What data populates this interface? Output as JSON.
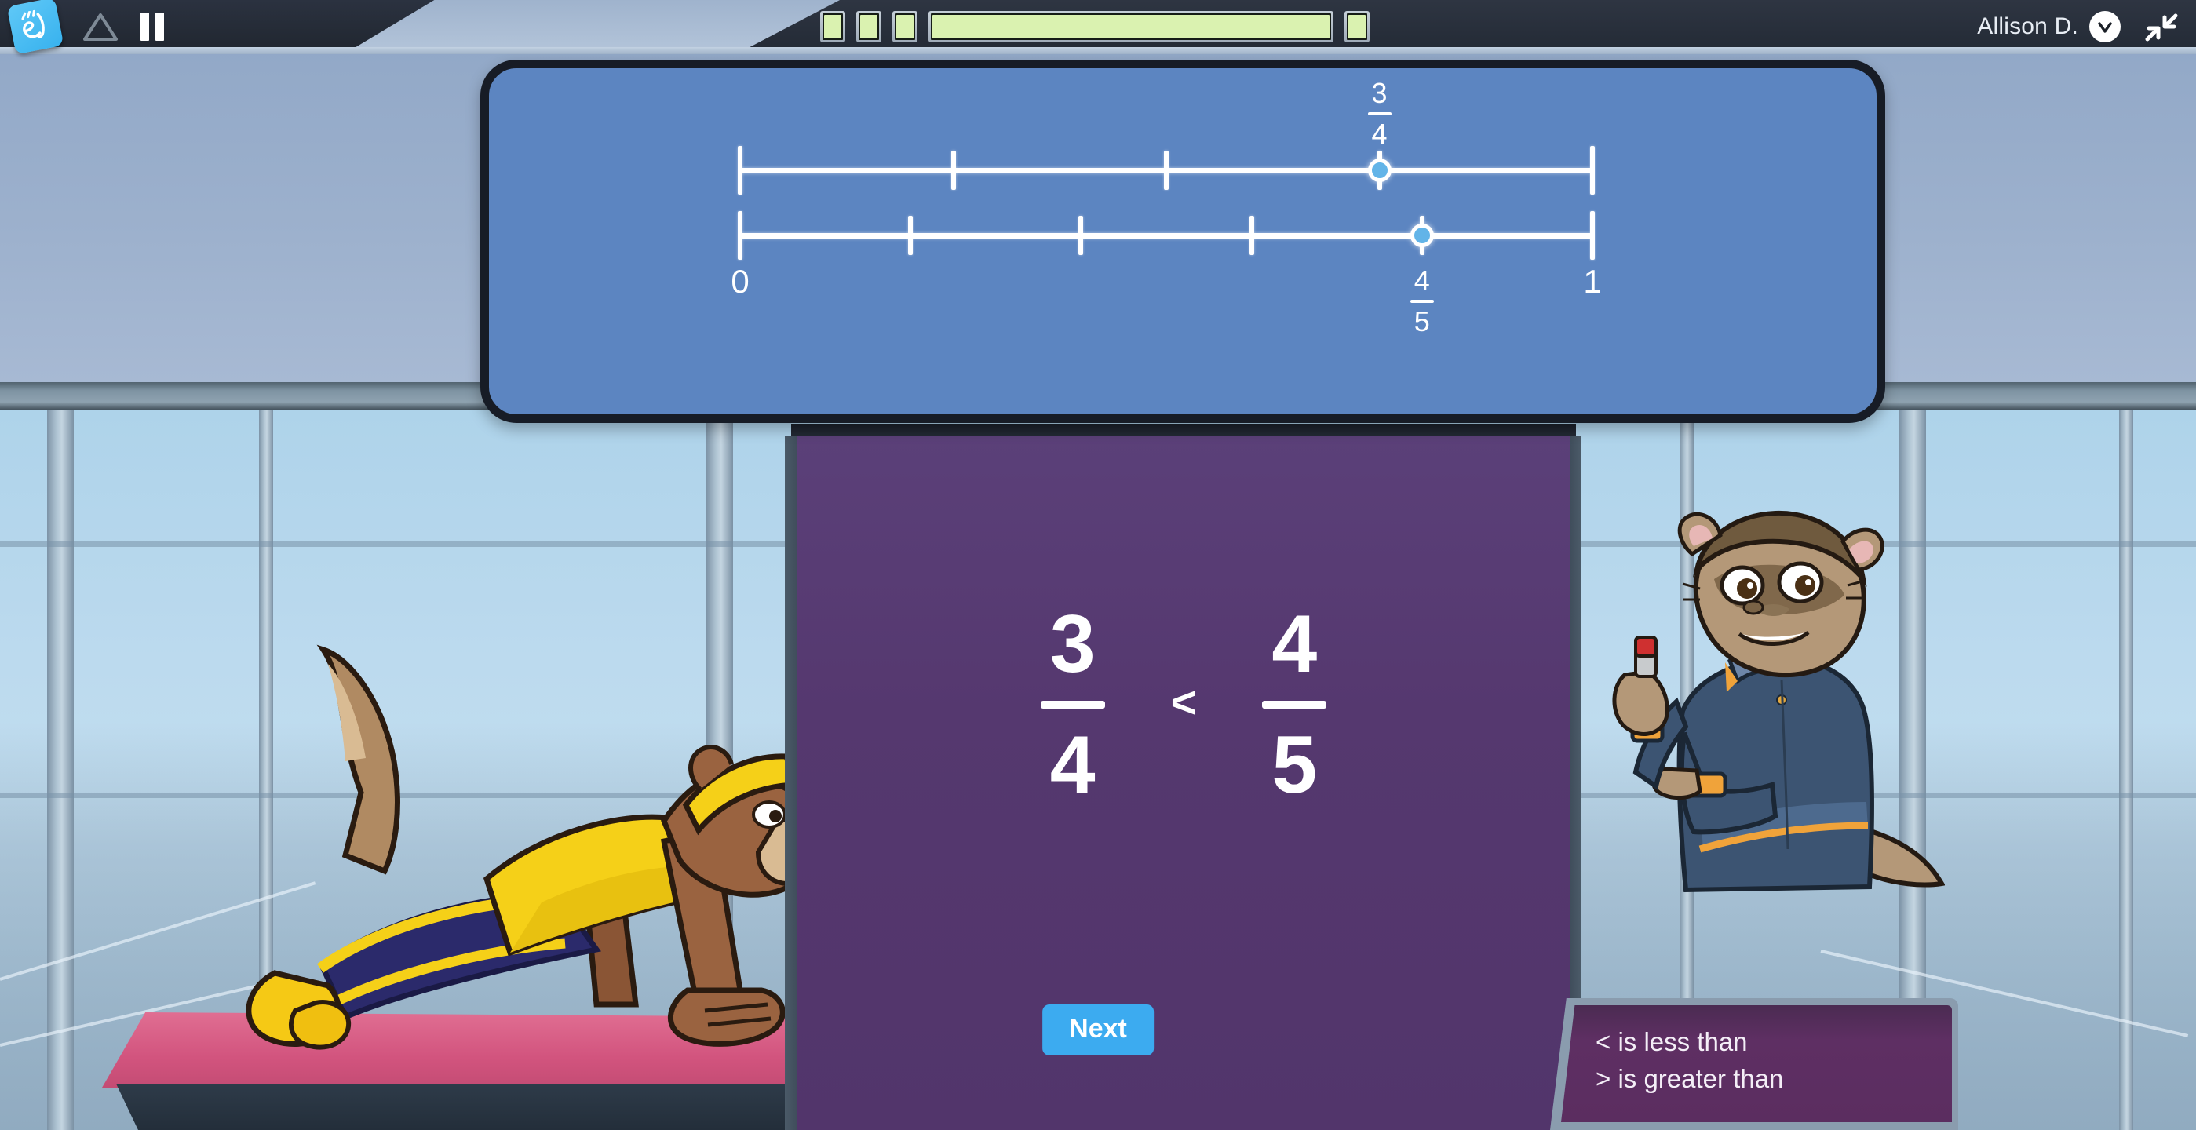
{
  "app": {
    "logo_icon": "cursive-el-logo-icon",
    "brand_mark": "el"
  },
  "toolbar": {
    "home_icon": "triangle-home-icon",
    "pause_icon": "pause-icon",
    "pause_label": "Pause",
    "fullscreen_icon": "exit-fullscreen-icon",
    "user_name": "Allison D.",
    "user_badge_icon": "verified-check-icon",
    "user_badge_letter": "V",
    "progress": {
      "segments": [
        {
          "type": "small",
          "filled": true
        },
        {
          "type": "small",
          "filled": true
        },
        {
          "type": "small",
          "filled": true
        },
        {
          "type": "long",
          "filled": true
        },
        {
          "type": "small",
          "filled": true
        }
      ],
      "fill_color": "#daf2b0",
      "frame_color": "#aab7c4"
    }
  },
  "number_lines": {
    "panel_color": "#5c85c1",
    "border_color": "#171c26",
    "end_labels": {
      "left": "0",
      "right": "1"
    },
    "lines": [
      {
        "id": "line-three-fourths",
        "denominator": 4,
        "marker_numerator": 3,
        "label_numerator": "3",
        "label_denominator": "4",
        "label_position": "above",
        "marker_fraction": 0.75
      },
      {
        "id": "line-four-fifths",
        "denominator": 5,
        "marker_numerator": 4,
        "label_numerator": "4",
        "label_denominator": "5",
        "label_position": "below",
        "marker_fraction": 0.8
      }
    ]
  },
  "board": {
    "background_color": "#553b74",
    "left_fraction": {
      "numerator": "3",
      "denominator": "4"
    },
    "operator": "<",
    "right_fraction": {
      "numerator": "4",
      "denominator": "5"
    },
    "next_label": "Next",
    "next_color": "#3cabf0"
  },
  "hint": {
    "line1": "< is less than",
    "line2": "> is greater than",
    "background_color": "#5b2d60"
  },
  "characters": [
    {
      "id": "student-plank",
      "name": "monkey-student-doing-plank",
      "outfit_top_color": "#f5d018",
      "outfit_bottom_color": "#2b2a6b",
      "headband_color": "#f5d018",
      "fur_color": "#9a6340",
      "mat_color": "#d2547e"
    },
    {
      "id": "teacher-ferret",
      "name": "ferret-teacher-with-marker",
      "uniform_color": "#3c5472",
      "trim_color": "#f0a33a",
      "fur_color": "#b49878",
      "marker_color": "#cf3030"
    }
  ]
}
